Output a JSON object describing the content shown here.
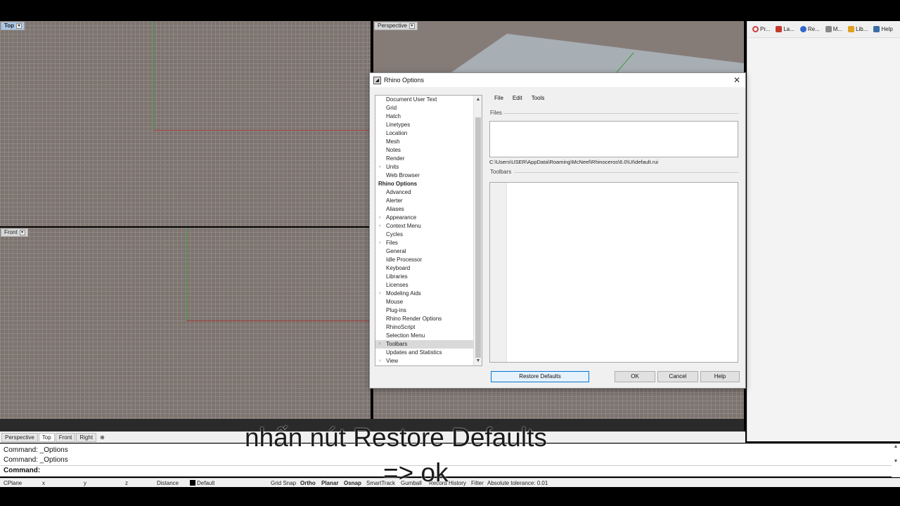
{
  "viewports": {
    "top": {
      "label": "Top"
    },
    "perspective": {
      "label": "Perspective"
    },
    "front": {
      "label": "Front"
    }
  },
  "right_panel": {
    "tabs": [
      {
        "label": "Pr...",
        "icon": "properties-icon",
        "color": "#d04040"
      },
      {
        "label": "La...",
        "icon": "layers-icon",
        "color": "#c43a2a"
      },
      {
        "label": "Re...",
        "icon": "render-icon",
        "color": "#3366cc"
      },
      {
        "label": "M...",
        "icon": "materials-icon",
        "color": "#888888"
      },
      {
        "label": "Lib...",
        "icon": "libraries-icon",
        "color": "#e0a020"
      },
      {
        "label": "Help",
        "icon": "help-icon",
        "color": "#3a6ea5"
      }
    ]
  },
  "dialog": {
    "title": "Rhino Options",
    "close": "✕",
    "tree": [
      {
        "label": "Document User Text"
      },
      {
        "label": "Grid"
      },
      {
        "label": "Hatch"
      },
      {
        "label": "Linetypes"
      },
      {
        "label": "Location"
      },
      {
        "label": "Mesh"
      },
      {
        "label": "Notes"
      },
      {
        "label": "Render"
      },
      {
        "label": "Units",
        "expandable": true
      },
      {
        "label": "Web Browser"
      },
      {
        "label": "Rhino Options",
        "header": true
      },
      {
        "label": "Advanced"
      },
      {
        "label": "Alerter"
      },
      {
        "label": "Aliases"
      },
      {
        "label": "Appearance",
        "expandable": true
      },
      {
        "label": "Context Menu",
        "expandable": true
      },
      {
        "label": "Cycles"
      },
      {
        "label": "Files",
        "expandable": true
      },
      {
        "label": "General"
      },
      {
        "label": "Idle Processor"
      },
      {
        "label": "Keyboard"
      },
      {
        "label": "Libraries"
      },
      {
        "label": "Licenses"
      },
      {
        "label": "Modeling Aids",
        "expandable": true
      },
      {
        "label": "Mouse"
      },
      {
        "label": "Plug-ins"
      },
      {
        "label": "Rhino Render Options"
      },
      {
        "label": "RhinoScript"
      },
      {
        "label": "Selection Menu"
      },
      {
        "label": "Toolbars",
        "expandable": true,
        "selected": true
      },
      {
        "label": "Updates and Statistics"
      },
      {
        "label": "View",
        "expandable": true
      }
    ],
    "menu": {
      "file": "File",
      "edit": "Edit",
      "tools": "Tools"
    },
    "files_label": "Files",
    "path": "C:\\Users\\USER\\AppData\\Roaming\\McNeel\\Rhinoceros\\6.0\\UI\\default.rui",
    "toolbars_label": "Toolbars",
    "buttons": {
      "restore_defaults": "Restore Defaults",
      "ok": "OK",
      "cancel": "Cancel",
      "help": "Help"
    }
  },
  "viewport_tabs": [
    "Perspective",
    "Top",
    "Front",
    "Right"
  ],
  "viewport_tabs_active": "Top",
  "add_tab": "⊕",
  "command": {
    "history": [
      "Command: _Options",
      "Command: _Options"
    ],
    "prompt": "Command:"
  },
  "status_bar": {
    "cplane": "CPlane",
    "x": "x",
    "y": "y",
    "z": "z",
    "distance": "Distance",
    "layer": "Default",
    "grid_snap": "Grid Snap",
    "ortho": "Ortho",
    "planar": "Planar",
    "osnap": "Osnap",
    "smarttrack": "SmartTrack",
    "gumball": "Gumball",
    "record_history": "Record History",
    "filter": "Filter",
    "tolerance": "Absolute tolerance: 0.01"
  },
  "captions": {
    "line1": "nhấn nút Restore Defaults",
    "line2": "=> ok"
  }
}
